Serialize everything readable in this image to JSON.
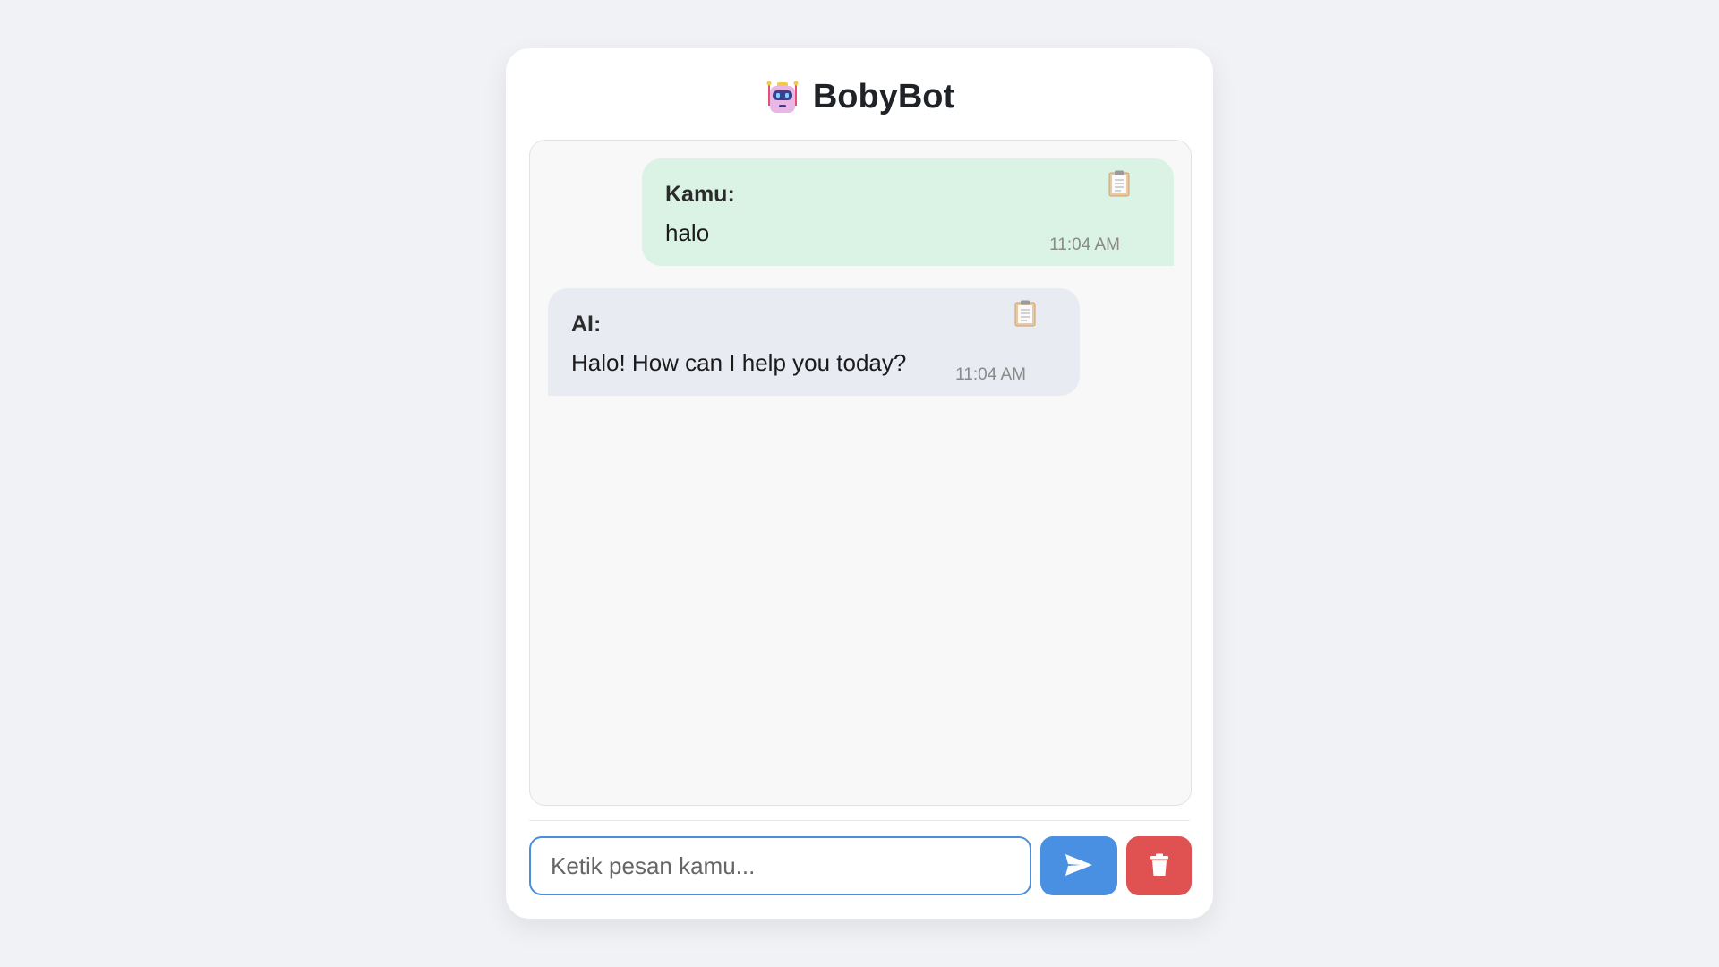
{
  "app": {
    "title": "BobyBot",
    "icon": "robot-icon"
  },
  "messages": [
    {
      "role": "user",
      "sender": "Kamu:",
      "text": "halo",
      "time": "11:04 AM",
      "color": "#daf3e4"
    },
    {
      "role": "ai",
      "sender": "AI:",
      "text": "Halo! How can I help you today?",
      "time": "11:04 AM",
      "color": "#e8ebf2"
    }
  ],
  "composer": {
    "value": "",
    "placeholder": "Ketik pesan kamu...",
    "send_icon": "send-icon",
    "delete_icon": "trash-icon",
    "send_color": "#4a90e2",
    "delete_color": "#e05252"
  }
}
